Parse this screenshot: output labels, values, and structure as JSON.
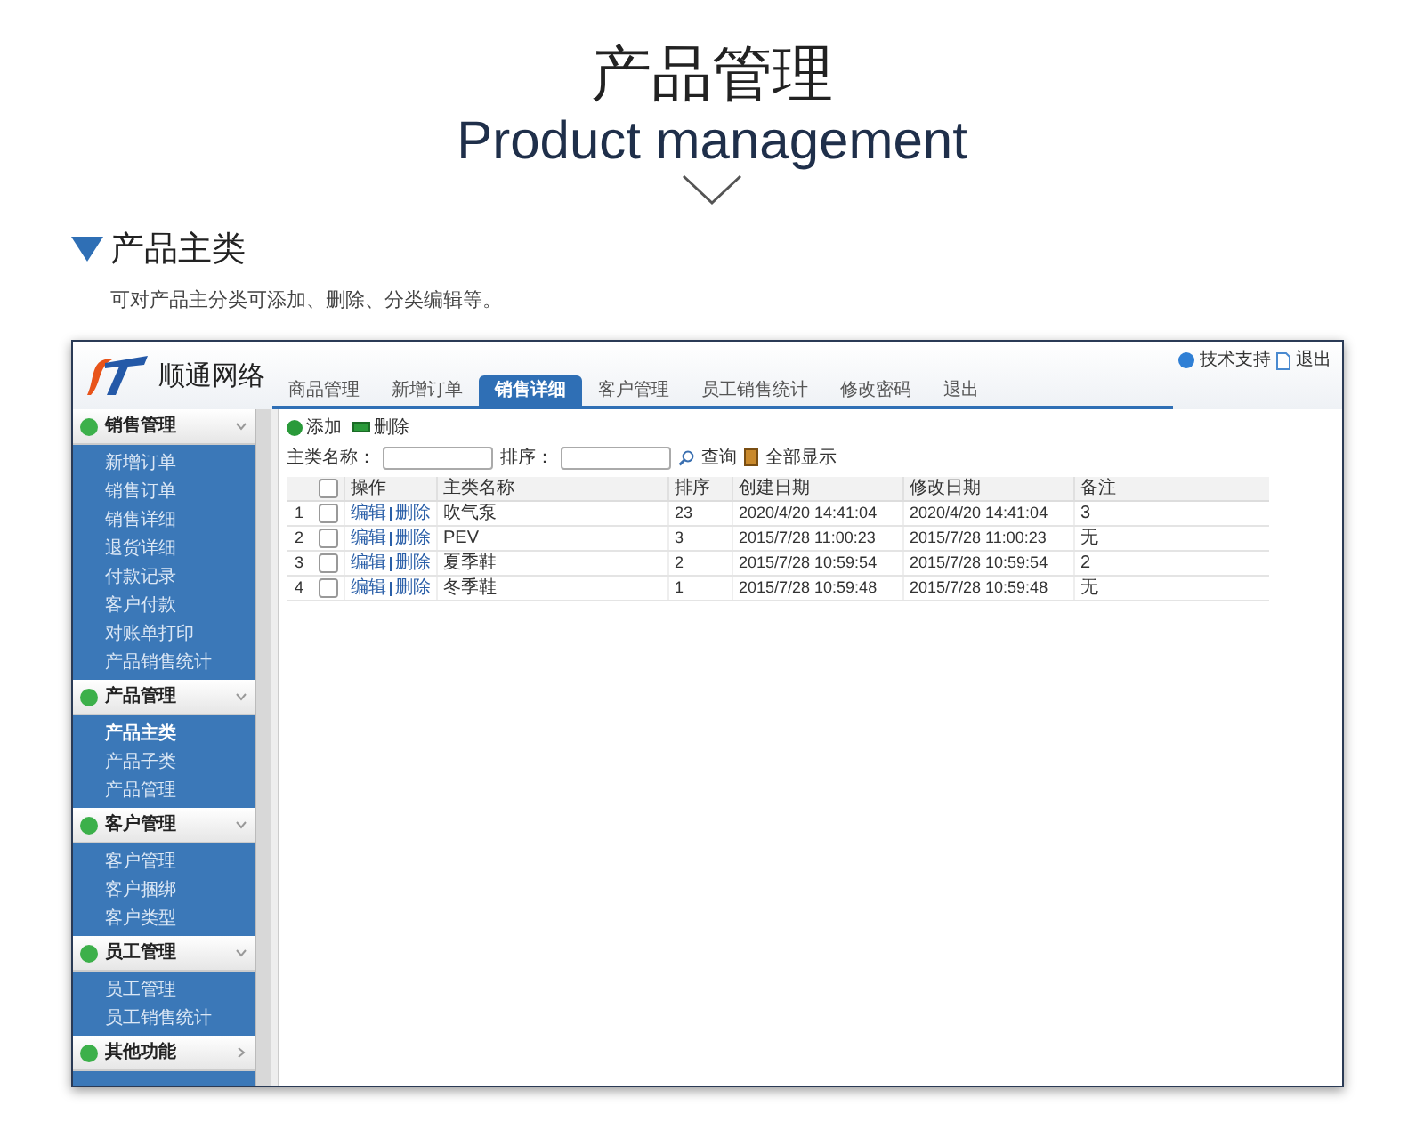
{
  "page_title": "产品管理",
  "page_subtitle": "Product management",
  "section": {
    "title": "产品主类",
    "description": "可对产品主分类可添加、删除、分类编辑等。"
  },
  "app": {
    "logo_text": "顺通网络",
    "top_links": [
      "技术支持",
      "退出"
    ],
    "tabs": [
      {
        "label": "商品管理",
        "selected": false
      },
      {
        "label": "新增订单",
        "selected": false
      },
      {
        "label": "销售详细",
        "selected": true
      },
      {
        "label": "客户管理",
        "selected": false
      },
      {
        "label": "员工销售统计",
        "selected": false
      },
      {
        "label": "修改密码",
        "selected": false
      },
      {
        "label": "退出",
        "selected": false
      }
    ],
    "sidebar": [
      {
        "label": "销售管理",
        "expanded": true,
        "children": [
          {
            "label": "新增订单",
            "selected": false
          },
          {
            "label": "销售订单",
            "selected": false
          },
          {
            "label": "销售详细",
            "selected": false
          },
          {
            "label": "退货详细",
            "selected": false
          },
          {
            "label": "付款记录",
            "selected": false
          },
          {
            "label": "客户付款",
            "selected": false
          },
          {
            "label": "对账单打印",
            "selected": false
          },
          {
            "label": "产品销售统计",
            "selected": false
          }
        ]
      },
      {
        "label": "产品管理",
        "expanded": true,
        "children": [
          {
            "label": "产品主类",
            "selected": true
          },
          {
            "label": "产品子类",
            "selected": false
          },
          {
            "label": "产品管理",
            "selected": false
          }
        ]
      },
      {
        "label": "客户管理",
        "expanded": true,
        "children": [
          {
            "label": "客户管理",
            "selected": false
          },
          {
            "label": "客户捆绑",
            "selected": false
          },
          {
            "label": "客户类型",
            "selected": false
          }
        ]
      },
      {
        "label": "员工管理",
        "expanded": true,
        "children": [
          {
            "label": "员工管理",
            "selected": false
          },
          {
            "label": "员工销售统计",
            "selected": false
          }
        ]
      },
      {
        "label": "其他功能",
        "expanded": false
      }
    ],
    "toolbar": {
      "add": "添加",
      "delete": "删除"
    },
    "search": {
      "name_label": "主类名称：",
      "sort_label": "排序：",
      "query": "查询",
      "show_all": "全部显示"
    },
    "table": {
      "all_checked": false,
      "columns": [
        "操作",
        "主类名称",
        "排序",
        "创建日期",
        "修改日期",
        "备注"
      ],
      "rows": [
        {
          "index": "1",
          "checked": false,
          "edit": "编辑",
          "delete": "删除",
          "name": "吹气泵",
          "sort": "23",
          "created": "2020/4/20 14:41:04",
          "modified": "2020/4/20 14:41:04",
          "note": "3"
        },
        {
          "index": "2",
          "checked": false,
          "edit": "编辑",
          "delete": "删除",
          "name": "PEV",
          "sort": "3",
          "created": "2015/7/28 11:00:23",
          "modified": "2015/7/28 11:00:23",
          "note": "无"
        },
        {
          "index": "3",
          "checked": false,
          "edit": "编辑",
          "delete": "删除",
          "name": "夏季鞋",
          "sort": "2",
          "created": "2015/7/28 10:59:54",
          "modified": "2015/7/28 10:59:54",
          "note": "2"
        },
        {
          "index": "4",
          "checked": false,
          "edit": "编辑",
          "delete": "删除",
          "name": "冬季鞋",
          "sort": "1",
          "created": "2015/7/28 10:59:48",
          "modified": "2015/7/28 10:59:48",
          "note": "无"
        }
      ]
    }
  }
}
